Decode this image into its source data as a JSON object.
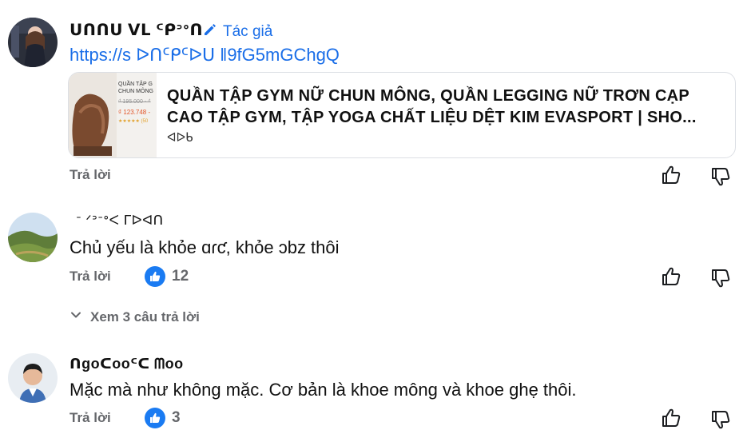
{
  "comments": [
    {
      "author": "ᑌᑎᑎᑌ ᐯᒪ ᑦᑭᐣᐤᑎ",
      "author_badge": "Tác giả",
      "link_text": "https://s ᐅᑎᑦᑭᑦᐅᑌ ‖9fG5mGChgQ",
      "preview": {
        "title": "QUẦN TẬP GYM NỮ CHUN MÔNG, QUẦN LEGGING NỮ TRƠN CẠP CAO TẬP GYM, TẬP YOGA CHẤT LIỆU DỆT KIM EVASPORT | Sho...",
        "source": "ᐊᐅᑲ",
        "thumb_title": "QUẦN TẬP G\nCHUN MÔNG",
        "thumb_old_price": "₫ 195.000 - ₫",
        "thumb_price": "₫ 123.748 -",
        "thumb_rating": "★★★★★ (50"
      },
      "reply_label": "Trả lời"
    },
    {
      "author": "ᐨ ᐟᐣᐨᐤᐸ ᒥᐅᐊᑎ",
      "text": "Chủ yếu là khỏe ɑɾƈ, khỏe ɔbz thôi",
      "reply_label": "Trả lời",
      "like_count": "12",
      "view_replies": "Xem 3 câu trả lời"
    },
    {
      "author": "ᑎgoᑕooᑦᑕ ᗰoo",
      "text": "Mặc mà như không mặc. Cơ bản là khoe mông và khoe ghẹ thôi.",
      "reply_label": "Trả lời",
      "like_count": "3"
    }
  ],
  "colors": {
    "link": "#1a6ee8",
    "like": "#1a7bf2",
    "muted": "#65676b"
  },
  "icons": [
    "pencil-icon",
    "thumbs-up-icon",
    "thumbs-down-icon",
    "chevron-down-icon"
  ]
}
